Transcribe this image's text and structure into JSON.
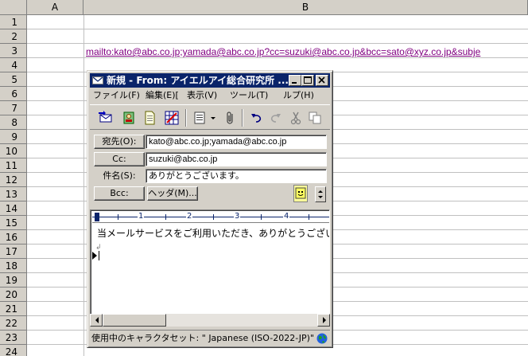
{
  "spreadsheet": {
    "columns": [
      "A",
      "B"
    ],
    "rows": [
      "1",
      "2",
      "3",
      "4",
      "5",
      "6",
      "7",
      "8",
      "9",
      "10",
      "11",
      "12",
      "13",
      "14",
      "15",
      "16",
      "17",
      "18",
      "19",
      "20",
      "21",
      "22",
      "23",
      "24"
    ],
    "b3_link": "mailto:kato@abc.co.jp;yamada@abc.co.jp?cc=suzuki@abc.co.jp&bcc=sato@xyz.co.jp&subje"
  },
  "window": {
    "title": "新規 - From: アイエルアイ総合研究所  ...",
    "menu": [
      "ファイル(F)",
      "編集(E)[",
      "表示(V)",
      "ツール(T)",
      "ルプ(H)"
    ]
  },
  "headers": {
    "to_button": "宛先(O):",
    "to_value": "kato@abc.co.jp;yamada@abc.co.jp",
    "cc_button": "Cc:",
    "cc_value": "suzuki@abc.co.jp",
    "subject_label": "件名(S):",
    "subject_value": "ありがとうございます。",
    "bcc_button": "Bcc:",
    "header_button": "ヘッダ(M)..."
  },
  "ruler": [
    "1",
    "2",
    "3",
    "4"
  ],
  "body": {
    "text": "当メールサービスをご利用いただき、ありがとうございます。",
    "return_mark": "↲"
  },
  "status": {
    "charset": "使用中のキャラクタセット: \" Japanese (ISO-2022-JP)\""
  },
  "colors": {
    "titlebar": "#0a246a",
    "link": "#800080",
    "face": "#d4d0c8"
  }
}
